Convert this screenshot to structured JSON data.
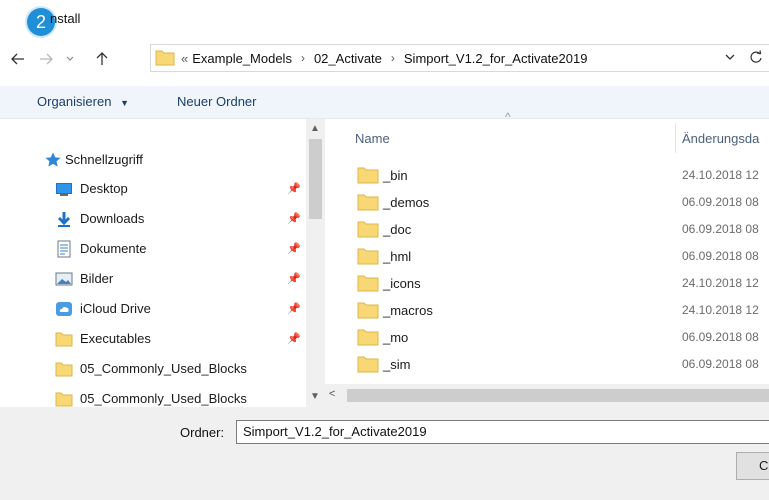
{
  "window": {
    "step_badge": "2",
    "title": "nstall"
  },
  "nav": {
    "back_icon": "back-arrow-icon",
    "forward_icon": "forward-arrow-icon",
    "recent_icon": "chevron-down-icon",
    "up_icon": "up-arrow-icon",
    "breadcrumb_overflow": "«",
    "breadcrumb": [
      "Example_Models",
      "02_Activate",
      "Simport_V1.2_for_Activate2019"
    ],
    "dropdown_icon": "chevron-down-icon",
    "refresh_icon": "refresh-icon"
  },
  "toolbar": {
    "organize_label": "Organisieren",
    "new_folder_label": "Neuer Ordner"
  },
  "sidebar": {
    "quick_access": "Schnellzugriff",
    "items": [
      {
        "label": "Desktop",
        "icon": "desktop-icon",
        "pinned": true
      },
      {
        "label": "Downloads",
        "icon": "download-icon",
        "pinned": true
      },
      {
        "label": "Dokumente",
        "icon": "document-icon",
        "pinned": true
      },
      {
        "label": "Bilder",
        "icon": "pictures-icon",
        "pinned": true
      },
      {
        "label": "iCloud Drive",
        "icon": "cloud-icon",
        "pinned": true
      },
      {
        "label": "Executables",
        "icon": "folder-icon",
        "pinned": true
      },
      {
        "label": "05_Commonly_Used_Blocks",
        "icon": "folder-icon",
        "pinned": false
      },
      {
        "label": "05_Commonly_Used_Blocks",
        "icon": "folder-icon",
        "pinned": false
      }
    ]
  },
  "filelist": {
    "columns": {
      "name": "Name",
      "date": "Änderungsda"
    },
    "rows": [
      {
        "name": "_bin",
        "date": "24.10.2018 12"
      },
      {
        "name": "_demos",
        "date": "06.09.2018 08"
      },
      {
        "name": "_doc",
        "date": "06.09.2018 08"
      },
      {
        "name": "_hml",
        "date": "06.09.2018 08"
      },
      {
        "name": "_icons",
        "date": "24.10.2018 12"
      },
      {
        "name": "_macros",
        "date": "24.10.2018 12"
      },
      {
        "name": "_mo",
        "date": "06.09.2018 08"
      },
      {
        "name": "_sim",
        "date": "06.09.2018 08"
      }
    ]
  },
  "footer": {
    "folder_label": "Ordner:",
    "folder_value": "Simport_V1.2_for_Activate2019",
    "action_button": "C"
  },
  "colors": {
    "accent": "#1f8fd8",
    "toolbar_bg": "#f0f5fb",
    "folder_yellow": "#f8d775"
  }
}
